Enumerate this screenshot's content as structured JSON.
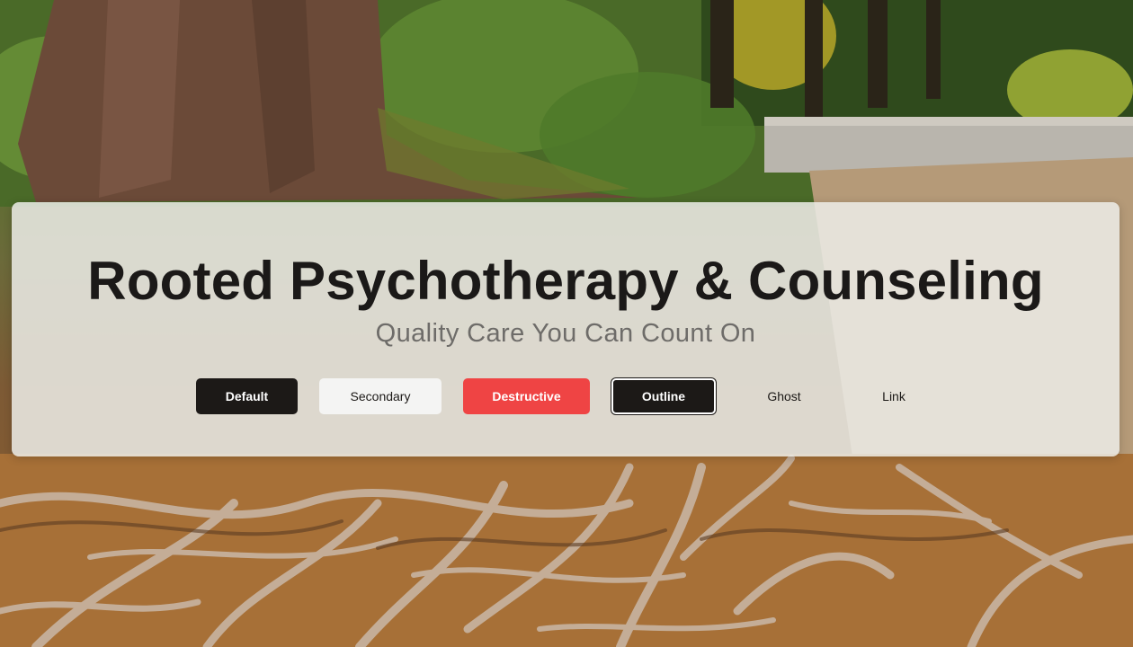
{
  "hero": {
    "title": "Rooted Psychotherapy & Counseling",
    "subtitle": "Quality Care You Can Count On"
  },
  "buttons": {
    "default_label": "Default",
    "secondary_label": "Secondary",
    "destructive_label": "Destructive",
    "outline_label": "Outline",
    "ghost_label": "Ghost",
    "link_label": "Link"
  },
  "colors": {
    "primary": "#1c1917",
    "secondary": "#f4f4f3",
    "destructive": "#ef4444",
    "card_background": "#ececE8",
    "title_text": "#1b1918",
    "subtitle_text": "#6e6c69"
  },
  "background": {
    "image": "forest-tree-roots-photo"
  }
}
